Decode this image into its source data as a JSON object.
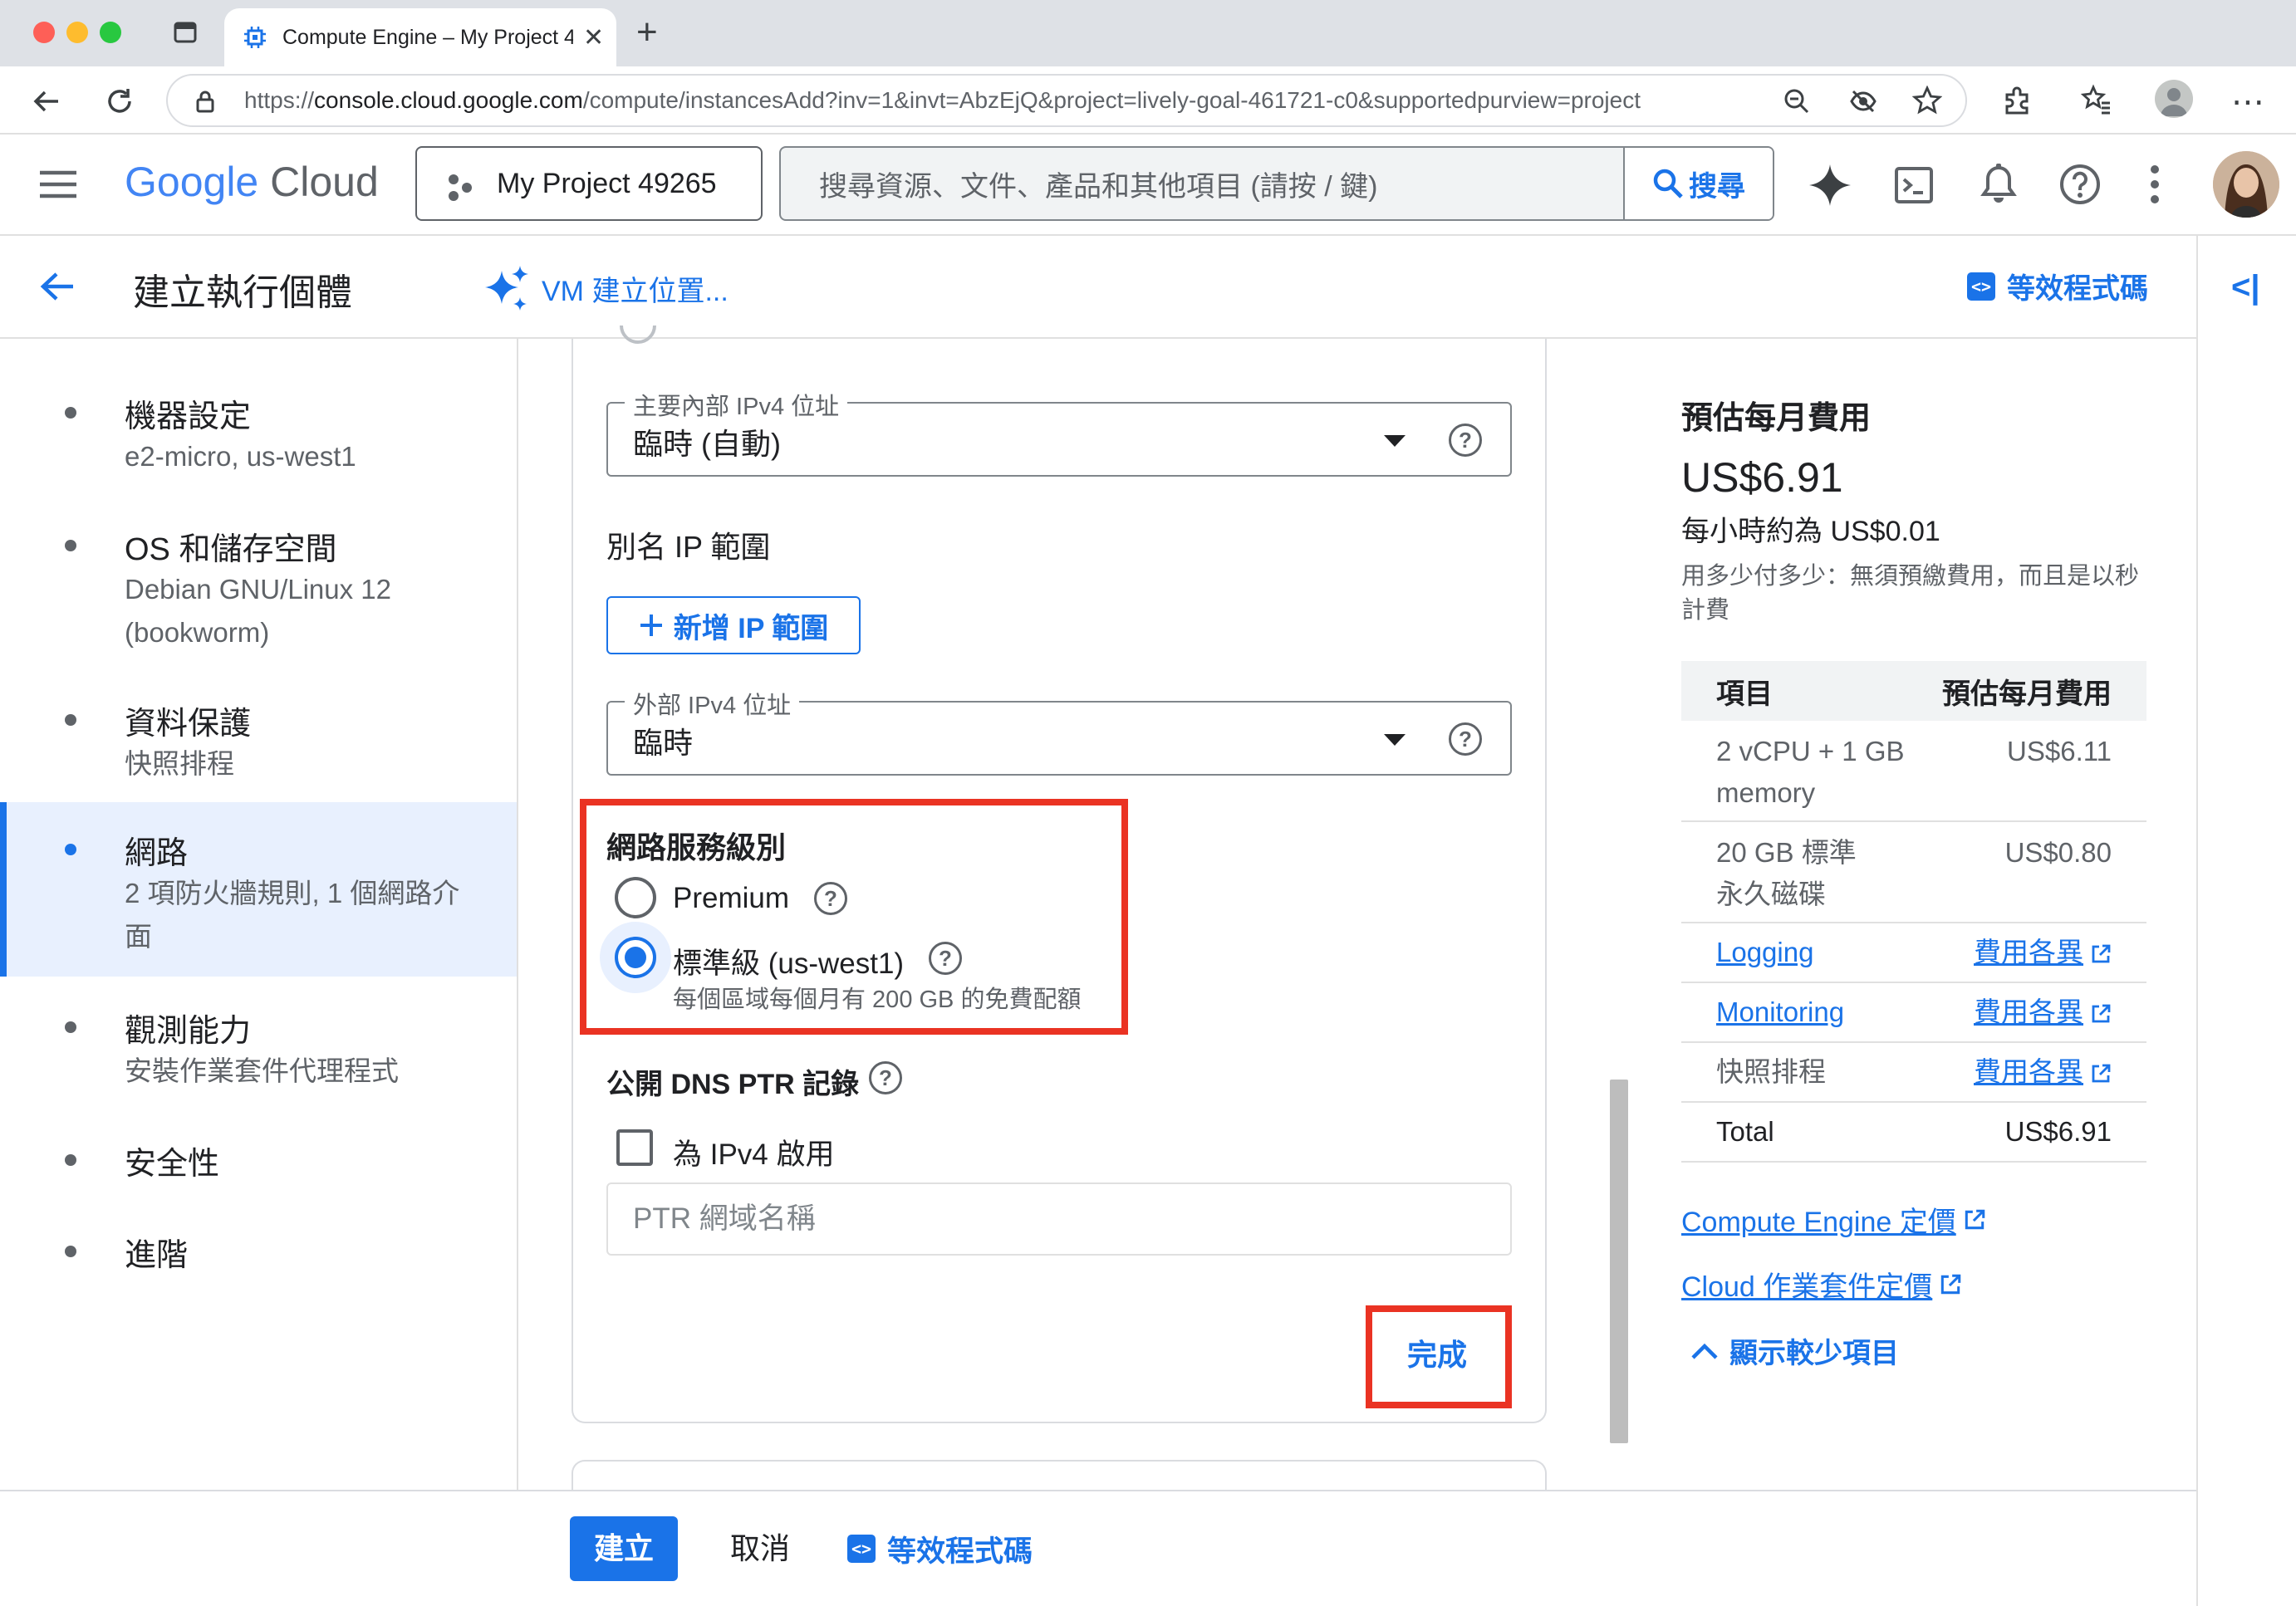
{
  "browser": {
    "tab_title": "Compute Engine – My Project 4",
    "url_prefix": "https://",
    "url_host": "console.cloud.google.com",
    "url_path": "/compute/instancesAdd?inv=1&invt=AbzEjQ&project=lively-goal-461721-c0&supportedpurview=project"
  },
  "header": {
    "logo_google": "Google",
    "logo_cloud": "Cloud",
    "project_name": "My Project 49265",
    "search_placeholder": "搜尋資源、文件、產品和其他項目 (請按 / 鍵)",
    "search_button": "搜尋"
  },
  "subheader": {
    "title": "建立執行個體",
    "helper": "VM 建立位置...",
    "equivalent_code": "等效程式碼"
  },
  "nav": {
    "items": [
      {
        "label": "機器設定",
        "sub": "e2-micro, us-west1"
      },
      {
        "label": "OS 和儲存空間",
        "sub": "Debian GNU/Linux 12 (bookworm)"
      },
      {
        "label": "資料保護",
        "sub": "快照排程"
      },
      {
        "label": "網路",
        "sub": "2 項防火牆規則, 1 個網路介面"
      },
      {
        "label": "觀測能力",
        "sub": "安裝作業套件代理程式"
      },
      {
        "label": "安全性",
        "sub": ""
      },
      {
        "label": "進階",
        "sub": ""
      }
    ]
  },
  "form": {
    "primary_ip_label": "主要內部 IPv4 位址",
    "primary_ip_value": "臨時 (自動)",
    "alias_title": "別名 IP 範圍",
    "add_ip_button": "新增 IP 範圍",
    "external_ip_label": "外部 IPv4 位址",
    "external_ip_value": "臨時",
    "tier_title": "網路服務級別",
    "tier_premium": "Premium",
    "tier_standard": "標準級 (us-west1)",
    "tier_standard_note": "每個區域每個月有 200 GB 的免費配額",
    "dns_title": "公開 DNS PTR 記錄",
    "dns_enable": "為 IPv4 啟用",
    "ptr_placeholder": "PTR 網域名稱",
    "done_button": "完成"
  },
  "cost": {
    "title": "預估每月費用",
    "monthly": "US$6.91",
    "hourly": "每小時約為 US$0.01",
    "note": "用多少付多少：無須預繳費用，而且是以秒計費",
    "col_item": "項目",
    "col_cost": "預估每月費用",
    "rows": [
      {
        "item": "2 vCPU + 1 GB memory",
        "cost": "US$6.11"
      },
      {
        "item": "20 GB 標準永久磁碟",
        "cost": "US$0.80"
      },
      {
        "item": "Logging",
        "cost": "費用各異"
      },
      {
        "item": "Monitoring",
        "cost": "費用各異"
      },
      {
        "item": "快照排程",
        "cost": "費用各異"
      },
      {
        "item": "Total",
        "cost": "US$6.91"
      }
    ],
    "link_compute": "Compute Engine 定價",
    "link_ops": "Cloud 作業套件定價",
    "show_less": "顯示較少項目"
  },
  "footer": {
    "create": "建立",
    "cancel": "取消",
    "equivalent_code": "等效程式碼"
  },
  "colors": {
    "accent": "#1a73e8",
    "highlight": "#ea3323"
  }
}
